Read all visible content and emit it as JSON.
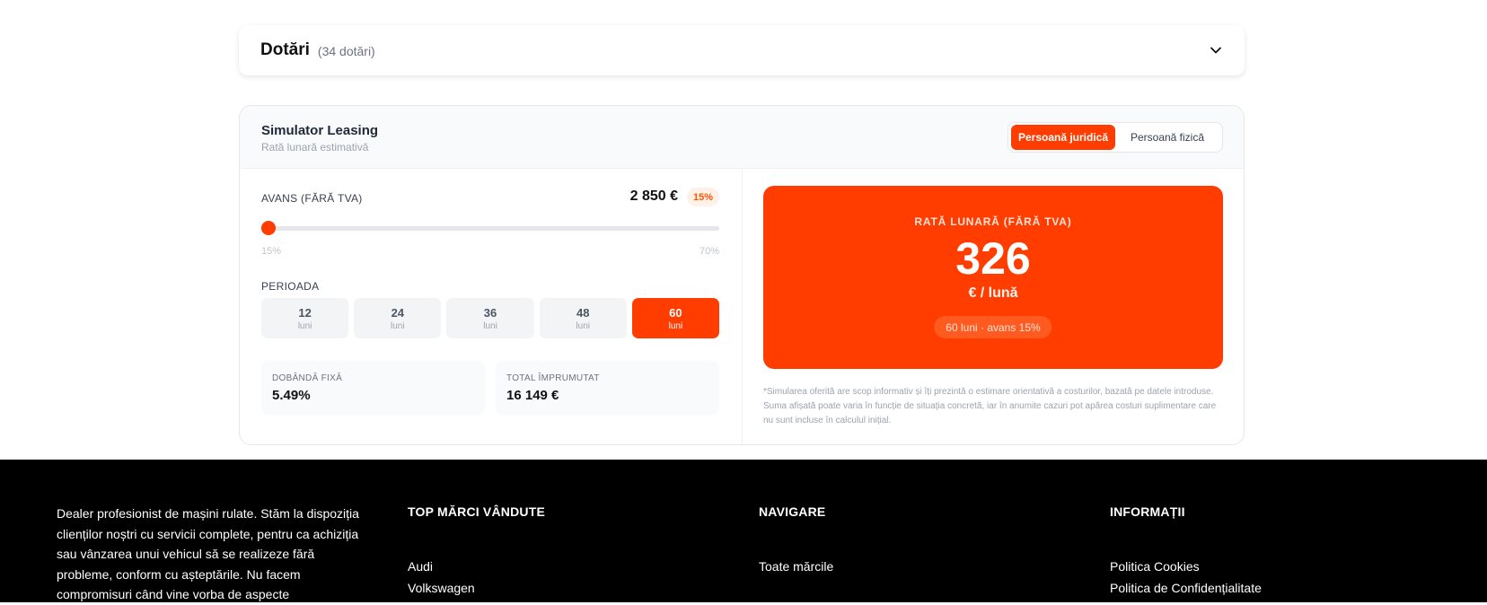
{
  "dotari": {
    "title": "Dotări",
    "count": "(34 dotări)",
    "toggle_icon": "chevron-down-icon"
  },
  "simulator": {
    "title": "Simulator Leasing",
    "subtitle": "Rată lunară estimativă",
    "person_types": [
      {
        "label": "Persoană juridică",
        "active": true
      },
      {
        "label": "Persoană fizică",
        "active": false
      }
    ],
    "avans": {
      "label": "AVANS (FĂRĂ TVA)",
      "value": "2 850 €",
      "percent_badge": "15%",
      "slider_min_label": "15%",
      "slider_max_label": "70%",
      "slider_min": 15,
      "slider_max": 70,
      "slider_value": 15
    },
    "perioada": {
      "label": "PERIOADA",
      "options": [
        {
          "value": "12",
          "unit": "luni",
          "active": false
        },
        {
          "value": "24",
          "unit": "luni",
          "active": false
        },
        {
          "value": "36",
          "unit": "luni",
          "active": false
        },
        {
          "value": "48",
          "unit": "luni",
          "active": false
        },
        {
          "value": "60",
          "unit": "luni",
          "active": true
        }
      ]
    },
    "stats": {
      "dobanda": {
        "label": "DOBÂNDĂ FIXĂ",
        "value": "5.49%"
      },
      "total": {
        "label": "TOTAL ÎMPRUMUTAT",
        "value": "16 149 €"
      }
    },
    "rate": {
      "label": "RATĂ LUNARĂ (FĂRĂ TVA)",
      "value": "326",
      "unit": "€ / lună",
      "summary": "60 luni · avans 15%"
    },
    "disclaimer": "*Simularea oferită are scop informativ și îți prezintă o estimare orientativă a costurilor, bazată pe datele introduse. Suma afișată poate varia în funcție de situația concretă, iar în anumite cazuri pot apărea costuri suplimentare care nu sunt incluse în calculul inițial."
  },
  "colors": {
    "accent": "#ff3d00",
    "footer_bg": "#000000"
  },
  "footer": {
    "about": "Dealer profesionist de mașini rulate. Stăm la dispoziția clienților noștri cu servicii complete, pentru ca achiziția sau vânzarea unui vehicul să se realizeze fără probleme, conform cu așteptările. Nu facem compromisuri când vine vorba de aspecte",
    "columns": [
      {
        "title": "TOP MĂRCI VÂNDUTE",
        "links": [
          "Audi",
          "Volkswagen"
        ]
      },
      {
        "title": "NAVIGARE",
        "links": [
          "Toate mărcile"
        ]
      },
      {
        "title": "INFORMAȚII",
        "links": [
          "Politica Cookies",
          "Politica de Confidențialitate"
        ]
      }
    ]
  }
}
